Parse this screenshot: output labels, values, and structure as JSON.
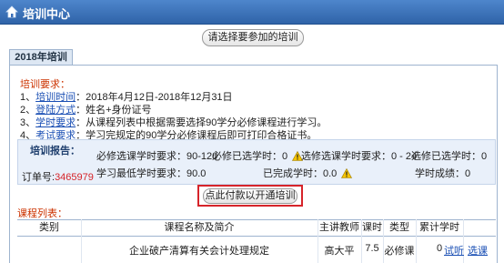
{
  "window": {
    "title": "培训中心"
  },
  "select_button": "请选择要参加的培训",
  "tab": "2018年培训",
  "requirements": {
    "heading": "培训要求：",
    "items": [
      {
        "num": "1、",
        "key": "培训时间",
        "value": "：2018年4月12日-2018年12月31日"
      },
      {
        "num": "2、",
        "key": "登陆方式",
        "value": "：姓名+身份证号"
      },
      {
        "num": "3、",
        "key": "学时要求",
        "value": "：从课程列表中根据需要选择90学分必修课程进行学习。"
      },
      {
        "num": "4、",
        "key": "考试要求",
        "value": "：学习完规定的90学分必修课程后即可打印合格证书。"
      }
    ]
  },
  "report": {
    "heading": "培训报告：",
    "order_label": "订单号:",
    "order_no": "3465979",
    "required_hours_label": "必修选课学时要求：",
    "required_hours_value": "90-120",
    "required_selected_label": "必修已选学时：",
    "required_selected_value": "0",
    "elective_hours_label": "选修选课学时要求：",
    "elective_hours_value": "0 - 24",
    "elective_selected_label": "选修已选学时：",
    "elective_selected_value": "0",
    "min_hours_label": "学习最低学时要求：",
    "min_hours_value": "90.0",
    "completed_label": "已完成学时：",
    "completed_value": "0.0",
    "score_label": "学时成绩：",
    "score_value": "0"
  },
  "pay_button": "点此付款以开通培训",
  "course_list": {
    "heading": "课程列表：",
    "headers": [
      "类别",
      "课程名称及简介",
      "主讲教师",
      "课时",
      "类型",
      "累计学时"
    ],
    "rows": [
      {
        "category": "",
        "name": "企业破产清算有关会计处理规定",
        "teacher": "高大平",
        "hours": "7.5",
        "type": "必修课",
        "accum": "0",
        "trial": "试听",
        "choose": "选课"
      }
    ]
  },
  "colors": {
    "titlebar": "#3a6fb8",
    "accent_red": "#d6242a",
    "link": "#1a4fb4"
  }
}
